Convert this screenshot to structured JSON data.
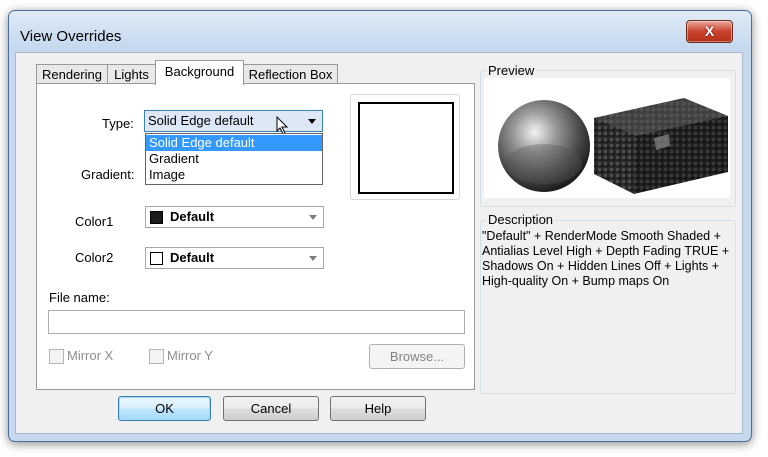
{
  "window": {
    "title": "View Overrides",
    "close_glyph": "X",
    "close_icon": "close-icon"
  },
  "tabs": [
    "Rendering",
    "Lights",
    "Background",
    "Reflection Box"
  ],
  "background": {
    "type_label": "Type:",
    "type_value": "Solid Edge default",
    "type_options": [
      "Solid Edge default",
      "Gradient",
      "Image"
    ],
    "gradient_label": "Gradient:",
    "color1_label": "Color1",
    "color1_value": "Default",
    "color1_swatch": "#1a1a1a",
    "color2_label": "Color2",
    "color2_value": "Default",
    "color2_swatch": "#ffffff",
    "filename_label": "File name:",
    "filename_value": "",
    "mirror_x_label": "Mirror X",
    "mirror_y_label": "Mirror Y",
    "browse_label": "Browse..."
  },
  "preview": {
    "title": "Preview"
  },
  "description": {
    "title": "Description",
    "text": "\"Default\" + RenderMode Smooth Shaded + Antialias Level High + Depth Fading TRUE + Shadows On + Hidden Lines Off + Lights + High-quality On + Bump maps On"
  },
  "buttons": {
    "ok": "OK",
    "cancel": "Cancel",
    "help": "Help"
  },
  "colors": {
    "selection": "#3399ff",
    "close_button": "#c9432d",
    "window_frame": "#c5d8ee"
  }
}
